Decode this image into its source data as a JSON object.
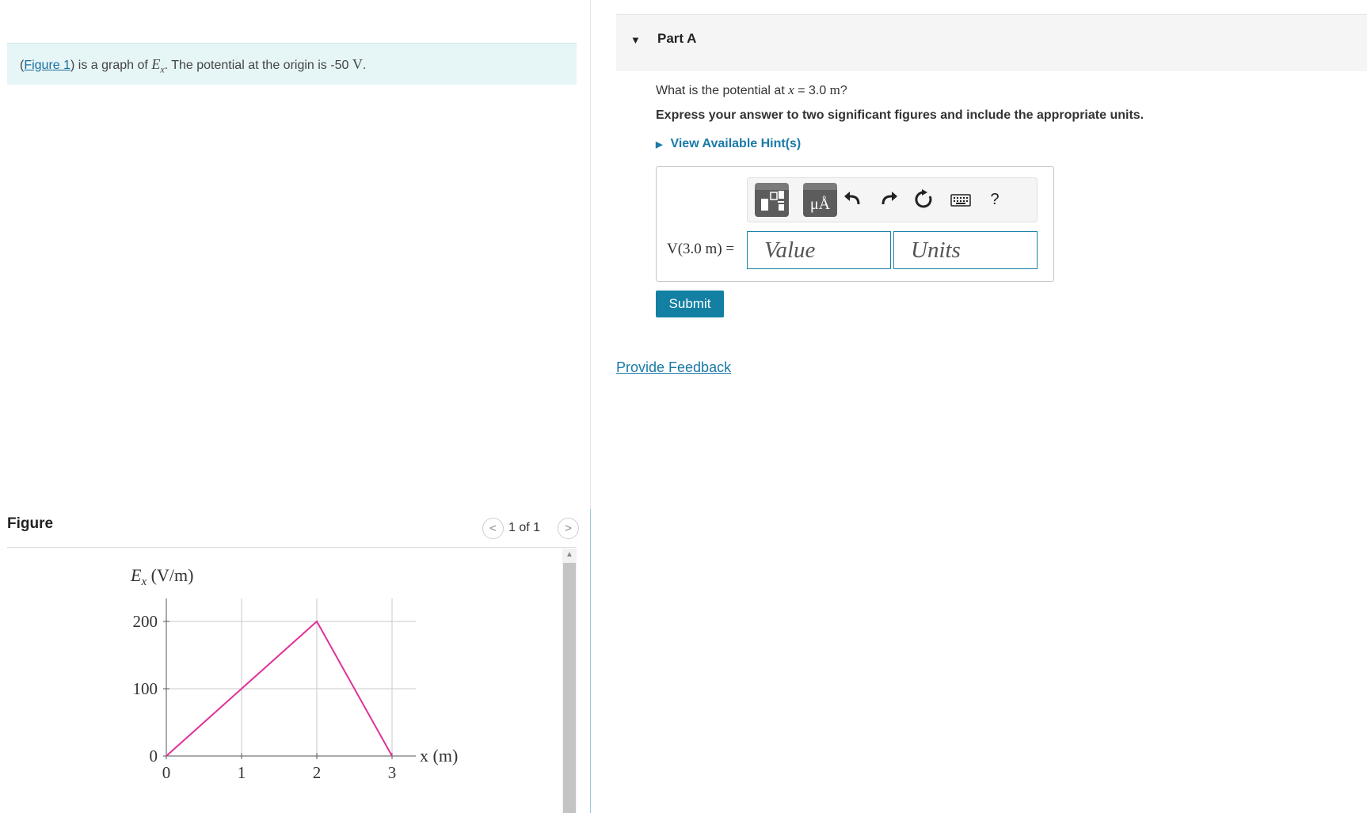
{
  "intro": {
    "open_paren": "(",
    "figure_link": "Figure 1",
    "text_before_var": ") is a graph of ",
    "var_main": "E",
    "var_sub": "x",
    "text_after_var": ". The potential at the origin is -50 ",
    "unit": "V",
    "end": "."
  },
  "figure": {
    "title": "Figure",
    "pager_text": "1 of 1",
    "prev_glyph": "<",
    "next_glyph": ">"
  },
  "chart_data": {
    "type": "line",
    "ylabel_main": "E",
    "ylabel_sub": "x",
    "ylabel_rest": " (V/m)",
    "xlabel": "x (m)",
    "x_ticks": [
      "0",
      "1",
      "2",
      "3"
    ],
    "y_ticks": [
      "0",
      "100",
      "200"
    ],
    "xlim": [
      0,
      3
    ],
    "ylim": [
      0,
      200
    ],
    "grid": true,
    "series": [
      {
        "x": [
          0,
          2,
          3
        ],
        "y": [
          0,
          200,
          0
        ],
        "color": "#e0329a"
      }
    ]
  },
  "part": {
    "caret": "▼",
    "title": "Part A"
  },
  "question": {
    "prefix": "What is the potential at ",
    "var": "x",
    "eq": " = 3.0 ",
    "unit": "m",
    "suffix": "?"
  },
  "instruction": "Express your answer to two significant figures and include the appropriate units.",
  "hints_label": "View Available Hint(s)",
  "answer": {
    "label": "V(3.0 m) =",
    "value_placeholder": "Value",
    "units_placeholder": "Units",
    "units_button": "μÅ",
    "help_glyph": "?"
  },
  "submit_label": "Submit",
  "feedback_label": "Provide Feedback"
}
